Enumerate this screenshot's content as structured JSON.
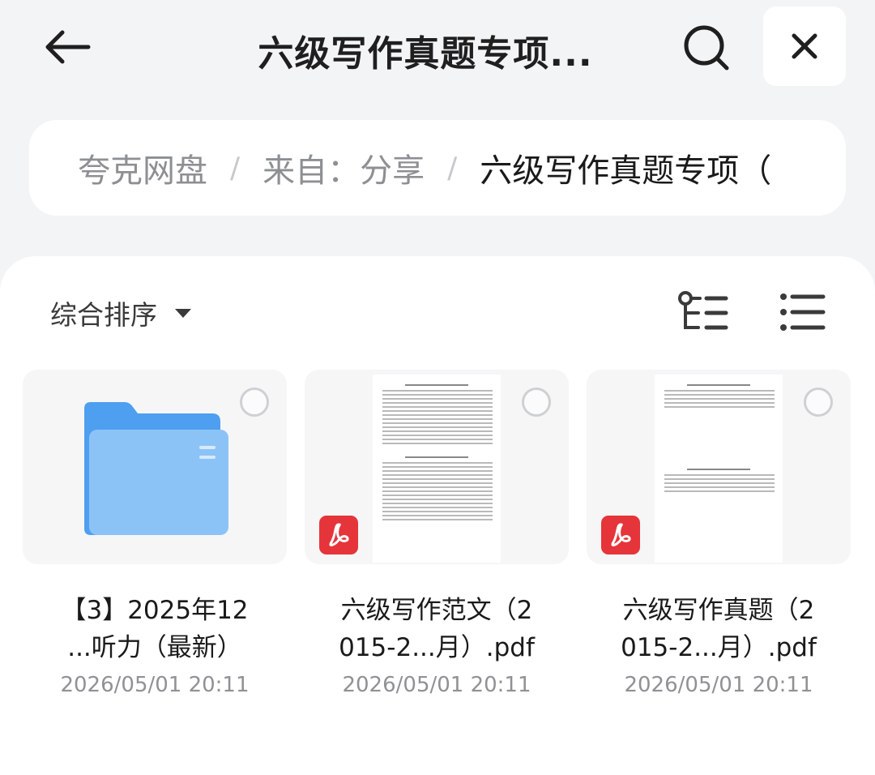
{
  "header": {
    "title": "六级写作真题专项...",
    "back_icon": "arrow-left-icon",
    "search_icon": "search-icon",
    "close_icon": "close-icon"
  },
  "breadcrumb": {
    "items": [
      "夸克网盘",
      "来自：分享",
      "六级写作真题专项（"
    ],
    "separator": "/"
  },
  "toolbar": {
    "sort_label": "综合排序",
    "sort_icon": "caret-down-icon",
    "tree_icon": "tree-view-icon",
    "list_icon": "list-view-icon"
  },
  "files": [
    {
      "type": "folder",
      "name_line1": "【3】2025年12",
      "name_line2": "...听力（最新）",
      "date": "2026/05/01 20:11"
    },
    {
      "type": "pdf",
      "name_line1": "六级写作范文（2",
      "name_line2": "015-2...月）.pdf",
      "date": "2026/05/01 20:11"
    },
    {
      "type": "pdf",
      "name_line1": "六级写作真题（2",
      "name_line2": "015-2...月）.pdf",
      "date": "2026/05/01 20:11"
    }
  ],
  "colors": {
    "folder": "#5aa9f0",
    "pdf_red": "#e5353a",
    "background": "#f3f4f6"
  }
}
